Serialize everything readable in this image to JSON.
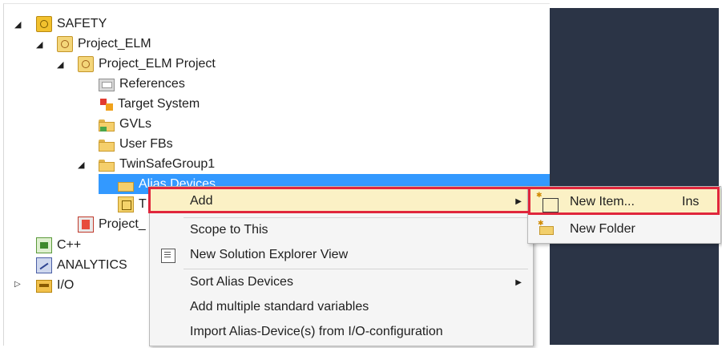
{
  "tree": {
    "items": [
      {
        "label": "SAFETY",
        "expander": "◢",
        "icon": "safety-icon"
      },
      {
        "label": "Project_ELM",
        "expander": "◢",
        "icon": "project-icon"
      },
      {
        "label": "Project_ELM Project",
        "expander": "◢",
        "icon": "project-icon"
      },
      {
        "label": "References",
        "icon": "references-icon"
      },
      {
        "label": "Target System",
        "icon": "target-system-icon"
      },
      {
        "label": "GVLs",
        "icon": "folder-icon"
      },
      {
        "label": "User FBs",
        "icon": "folder-icon"
      },
      {
        "label": "TwinSafeGroup1",
        "expander": "◢",
        "icon": "folder-open-icon"
      },
      {
        "label": "Alias Devices",
        "icon": "alias-devices-icon"
      },
      {
        "label": "T",
        "icon": "twinsafe-group-icon"
      },
      {
        "label": "Project_",
        "icon": "project-red-icon"
      },
      {
        "label": "C++",
        "icon": "cpp-icon"
      },
      {
        "label": "ANALYTICS",
        "icon": "analytics-icon"
      },
      {
        "label": "I/O",
        "expander": "▷",
        "icon": "io-icon"
      }
    ]
  },
  "context_menu": {
    "items": [
      {
        "label": "Add",
        "submenu_arrow": "▶"
      },
      {
        "label": "Scope to This"
      },
      {
        "label": "New Solution Explorer View"
      },
      {
        "label": "Sort Alias Devices",
        "submenu_arrow": "▶"
      },
      {
        "label": "Add multiple standard variables"
      },
      {
        "label": "Import Alias-Device(s) from I/O-configuration"
      }
    ]
  },
  "submenu": {
    "items": [
      {
        "label": "New Item...",
        "shortcut": "Ins"
      },
      {
        "label": "New Folder"
      }
    ]
  },
  "colors": {
    "selection": "#3399ff",
    "highlight": "#fbf1c5",
    "annotation_red": "#e0263c",
    "dark_panel": "#2b3446"
  }
}
